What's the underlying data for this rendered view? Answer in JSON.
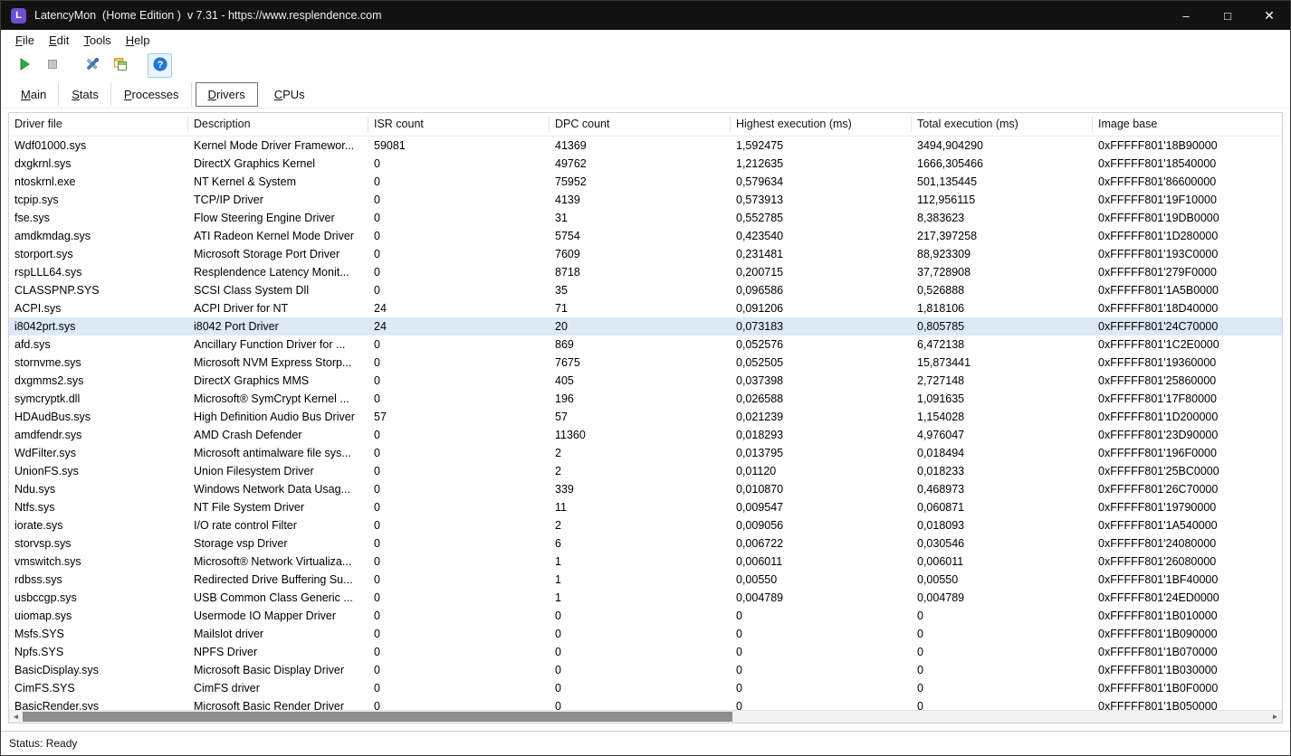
{
  "window": {
    "title": "LatencyMon  (Home Edition )  v 7.31 - https://www.resplendence.com",
    "icon_letter": "L",
    "controls": {
      "minimize": "–",
      "maximize": "□",
      "close": "✕"
    }
  },
  "menu": {
    "items": [
      "File",
      "Edit",
      "Tools",
      "Help"
    ]
  },
  "toolbar": {
    "buttons": [
      "start-monitor",
      "stop-monitor",
      "tools",
      "copy-report",
      "help"
    ]
  },
  "tabs": {
    "items": [
      "Main",
      "Stats",
      "Processes",
      "Drivers",
      "CPUs"
    ],
    "active": "Drivers"
  },
  "table": {
    "columns": [
      "Driver file",
      "Description",
      "ISR count",
      "DPC count",
      "Highest execution (ms)",
      "Total execution (ms)",
      "Image base"
    ],
    "selected_index": 10,
    "rows": [
      [
        "Wdf01000.sys",
        "Kernel Mode Driver Framewor...",
        "59081",
        "41369",
        "1,592475",
        "3494,904290",
        "0xFFFFF801'18B90000"
      ],
      [
        "dxgkrnl.sys",
        "DirectX Graphics Kernel",
        "0",
        "49762",
        "1,212635",
        "1666,305466",
        "0xFFFFF801'18540000"
      ],
      [
        "ntoskrnl.exe",
        "NT Kernel & System",
        "0",
        "75952",
        "0,579634",
        "501,135445",
        "0xFFFFF801'86600000"
      ],
      [
        "tcpip.sys",
        "TCP/IP Driver",
        "0",
        "4139",
        "0,573913",
        "112,956115",
        "0xFFFFF801'19F10000"
      ],
      [
        "fse.sys",
        "Flow Steering Engine Driver",
        "0",
        "31",
        "0,552785",
        "8,383623",
        "0xFFFFF801'19DB0000"
      ],
      [
        "amdkmdag.sys",
        "ATI Radeon Kernel Mode Driver",
        "0",
        "5754",
        "0,423540",
        "217,397258",
        "0xFFFFF801'1D280000"
      ],
      [
        "storport.sys",
        "Microsoft Storage Port Driver",
        "0",
        "7609",
        "0,231481",
        "88,923309",
        "0xFFFFF801'193C0000"
      ],
      [
        "rspLLL64.sys",
        "Resplendence Latency Monit...",
        "0",
        "8718",
        "0,200715",
        "37,728908",
        "0xFFFFF801'279F0000"
      ],
      [
        "CLASSPNP.SYS",
        "SCSI Class System Dll",
        "0",
        "35",
        "0,096586",
        "0,526888",
        "0xFFFFF801'1A5B0000"
      ],
      [
        "ACPI.sys",
        "ACPI Driver for NT",
        "24",
        "71",
        "0,091206",
        "1,818106",
        "0xFFFFF801'18D40000"
      ],
      [
        "i8042prt.sys",
        "i8042 Port Driver",
        "24",
        "20",
        "0,073183",
        "0,805785",
        "0xFFFFF801'24C70000"
      ],
      [
        "afd.sys",
        "Ancillary Function Driver for ...",
        "0",
        "869",
        "0,052576",
        "6,472138",
        "0xFFFFF801'1C2E0000"
      ],
      [
        "stornvme.sys",
        "Microsoft NVM Express Storp...",
        "0",
        "7675",
        "0,052505",
        "15,873441",
        "0xFFFFF801'19360000"
      ],
      [
        "dxgmms2.sys",
        "DirectX Graphics MMS",
        "0",
        "405",
        "0,037398",
        "2,727148",
        "0xFFFFF801'25860000"
      ],
      [
        "symcryptk.dll",
        "Microsoft® SymCrypt Kernel ...",
        "0",
        "196",
        "0,026588",
        "1,091635",
        "0xFFFFF801'17F80000"
      ],
      [
        "HDAudBus.sys",
        "High Definition Audio Bus Driver",
        "57",
        "57",
        "0,021239",
        "1,154028",
        "0xFFFFF801'1D200000"
      ],
      [
        "amdfendr.sys",
        "AMD Crash Defender",
        "0",
        "11360",
        "0,018293",
        "4,976047",
        "0xFFFFF801'23D90000"
      ],
      [
        "WdFilter.sys",
        "Microsoft antimalware file sys...",
        "0",
        "2",
        "0,013795",
        "0,018494",
        "0xFFFFF801'196F0000"
      ],
      [
        "UnionFS.sys",
        "Union Filesystem Driver",
        "0",
        "2",
        "0,01120",
        "0,018233",
        "0xFFFFF801'25BC0000"
      ],
      [
        "Ndu.sys",
        "Windows Network Data Usag...",
        "0",
        "339",
        "0,010870",
        "0,468973",
        "0xFFFFF801'26C70000"
      ],
      [
        "Ntfs.sys",
        "NT File System Driver",
        "0",
        "11",
        "0,009547",
        "0,060871",
        "0xFFFFF801'19790000"
      ],
      [
        "iorate.sys",
        "I/O rate control Filter",
        "0",
        "2",
        "0,009056",
        "0,018093",
        "0xFFFFF801'1A540000"
      ],
      [
        "storvsp.sys",
        "Storage vsp Driver",
        "0",
        "6",
        "0,006722",
        "0,030546",
        "0xFFFFF801'24080000"
      ],
      [
        "vmswitch.sys",
        "Microsoft® Network Virtualiza...",
        "0",
        "1",
        "0,006011",
        "0,006011",
        "0xFFFFF801'26080000"
      ],
      [
        "rdbss.sys",
        "Redirected Drive Buffering Su...",
        "0",
        "1",
        "0,00550",
        "0,00550",
        "0xFFFFF801'1BF40000"
      ],
      [
        "usbccgp.sys",
        "USB Common Class Generic ...",
        "0",
        "1",
        "0,004789",
        "0,004789",
        "0xFFFFF801'24ED0000"
      ],
      [
        "uiomap.sys",
        "Usermode IO Mapper Driver",
        "0",
        "0",
        "0",
        "0",
        "0xFFFFF801'1B010000"
      ],
      [
        "Msfs.SYS",
        "Mailslot driver",
        "0",
        "0",
        "0",
        "0",
        "0xFFFFF801'1B090000"
      ],
      [
        "Npfs.SYS",
        "NPFS Driver",
        "0",
        "0",
        "0",
        "0",
        "0xFFFFF801'1B070000"
      ],
      [
        "BasicDisplay.sys",
        "Microsoft Basic Display Driver",
        "0",
        "0",
        "0",
        "0",
        "0xFFFFF801'1B030000"
      ],
      [
        "CimFS.SYS",
        "CimFS driver",
        "0",
        "0",
        "0",
        "0",
        "0xFFFFF801'1B0F0000"
      ],
      [
        "BasicRender.sys",
        "Microsoft Basic Render Driver",
        "0",
        "0",
        "0",
        "0",
        "0xFFFFF801'1B050000"
      ]
    ]
  },
  "status": {
    "text": "Status: Ready"
  }
}
